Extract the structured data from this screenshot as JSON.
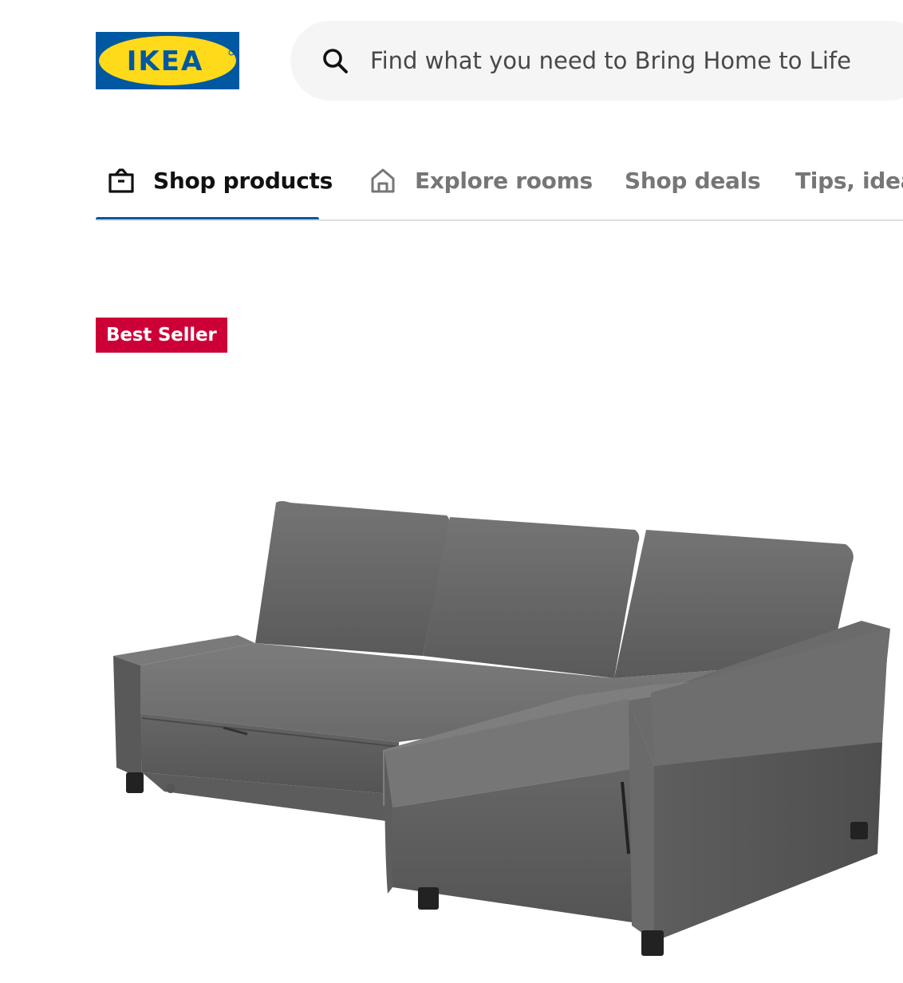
{
  "header": {
    "logo_text": "IKEA",
    "search": {
      "placeholder": "Find what you need to Bring Home to Life",
      "value": "",
      "icon": "search-icon"
    }
  },
  "nav": {
    "tabs": [
      {
        "label": "Shop products",
        "icon": "shop-bag-icon",
        "active": true
      },
      {
        "label": "Explore rooms",
        "icon": "house-icon",
        "active": false
      },
      {
        "label": "Shop deals",
        "active": false
      },
      {
        "label": "Tips, ideas",
        "active": false
      }
    ]
  },
  "product": {
    "badge": "Best Seller",
    "image_alt": "Gray corner sleeper sofa with storage chaise"
  },
  "colors": {
    "brand_blue": "#0058a3",
    "brand_yellow": "#ffda1a",
    "badge_red": "#cc0036",
    "search_bg": "#f5f5f5",
    "text_active": "#111111",
    "text_inactive": "#767676"
  }
}
